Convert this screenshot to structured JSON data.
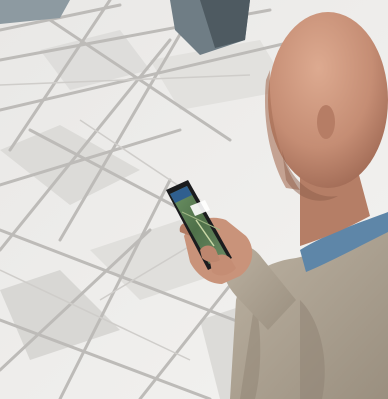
{
  "photo": {
    "colors": {
      "pavement": "#ecebea",
      "pavement_shadow": "#d9d8d6",
      "seam": "#bdbbb8",
      "glass": "#8d9aa1",
      "skin": "#c9937a",
      "skin_shadow": "#a66f57",
      "shirt_collar": "#5e86a8",
      "jacket": "#b0a594",
      "jacket_shadow": "#8f8474",
      "phone_body": "#1b1c1e",
      "phone_screen_map": "#5b7d57"
    },
    "subjects": [
      {
        "kind": "person",
        "icon": "bald-man"
      },
      {
        "kind": "device",
        "icon": "smartphone-map-app"
      },
      {
        "kind": "background",
        "icon": "tiled-plaza-pavement"
      }
    ]
  }
}
